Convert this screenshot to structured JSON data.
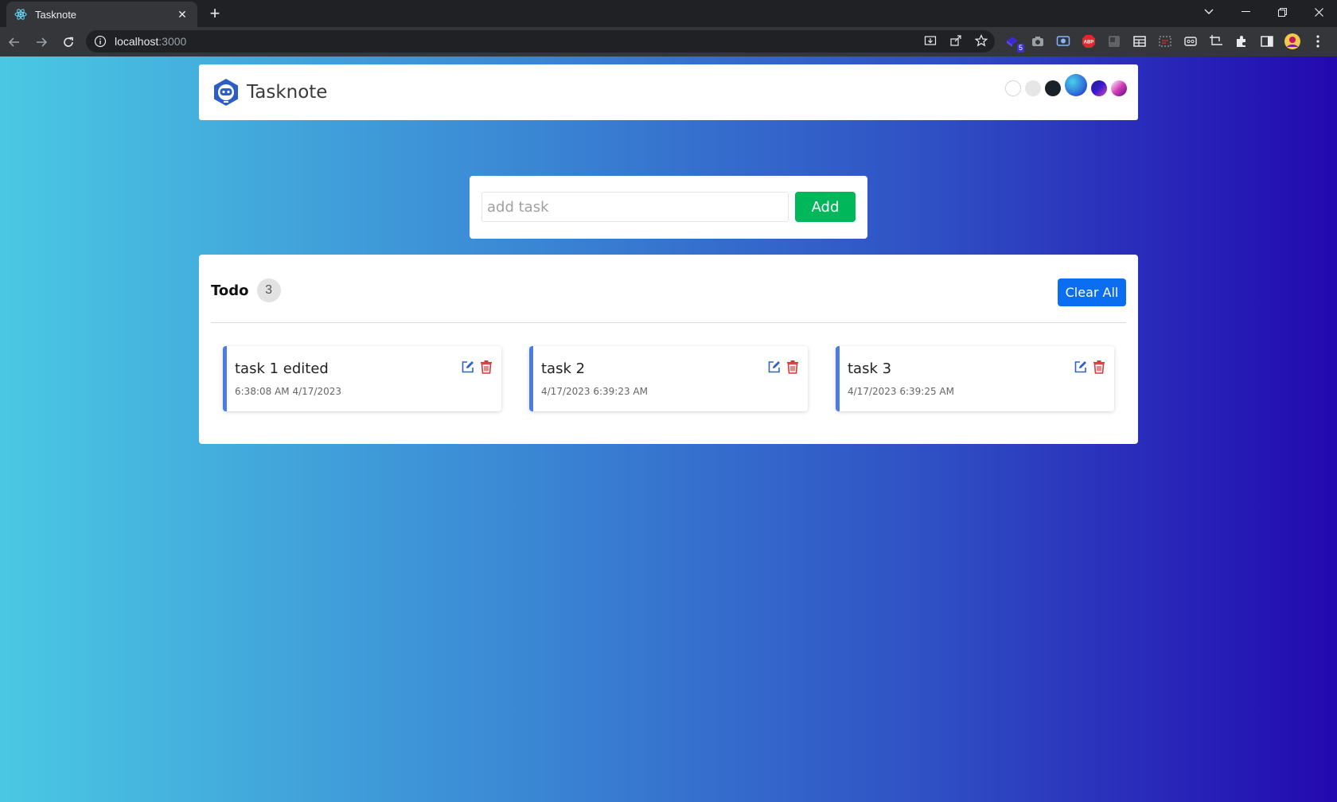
{
  "browser": {
    "tab_title": "Tasknote",
    "tab_close": "✕",
    "new_tab": "+",
    "url_host": "localhost",
    "url_port": ":3000",
    "extension_badge": "5"
  },
  "app": {
    "brand": "Tasknote",
    "themes": [
      {
        "name": "white",
        "color": "#ffffff"
      },
      {
        "name": "light-gray",
        "color": "#e6e6e6"
      },
      {
        "name": "dark",
        "color": "#1b2128"
      },
      {
        "name": "blue-gradient",
        "color": "#2f6fd8"
      },
      {
        "name": "purple",
        "color": "#3a1ad0"
      },
      {
        "name": "pink",
        "color": "#d23fb5"
      }
    ]
  },
  "add_form": {
    "placeholder": "add task",
    "button_label": "Add"
  },
  "todo": {
    "title": "Todo",
    "count": "3",
    "clear_label": "Clear All",
    "tasks": [
      {
        "name": "task 1 edited",
        "time": "6:38:08 AM 4/17/2023"
      },
      {
        "name": "task 2",
        "time": "4/17/2023 6:39:23 AM"
      },
      {
        "name": "task 3",
        "time": "4/17/2023 6:39:25 AM"
      }
    ]
  },
  "colors": {
    "add_button": "#00b85a",
    "clear_button": "#0b6ef0",
    "task_accent": "#4a7ddd",
    "edit_icon": "#2c63c9",
    "delete_icon": "#d9363e"
  }
}
